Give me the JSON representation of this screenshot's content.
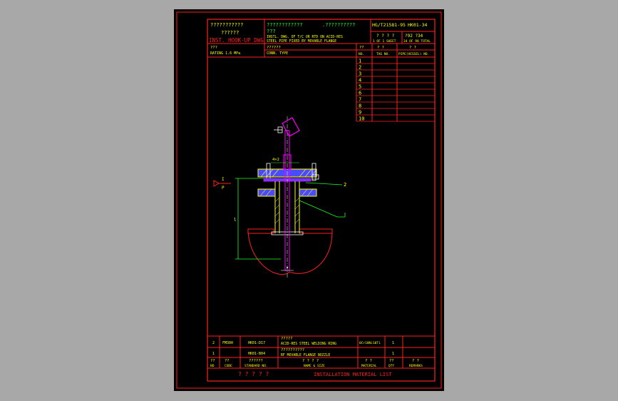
{
  "colors": {
    "frame": "#ff2020",
    "text": "#ffff00",
    "pipe": "#ff00ff",
    "blue": "#4a4aff",
    "green": "#20ff20",
    "white": "#ffffff",
    "cyan": "#00ffff"
  },
  "title_block": {
    "cn_inst": "???????????",
    "cn_hookup": "??????",
    "inst_hookup": "INST. HOOK-UP DWG",
    "cn_title_a": "????????????",
    "cn_title_b": ".??????????",
    "cn_title_c": "???",
    "en_title_1": "INSTL. DWG. OF T/C OR RTD ON ACID-RES",
    "en_title_2": "STEEL PIPE FIXED BY MOVABLE FLANGE",
    "std_no": "HG/T21581-95",
    "dwg_no": "HK01-34",
    "sheet_cn": "? ? ? ?",
    "sheet_val": "1 OF 1 SHEET",
    "total_cn": "?92 ?34",
    "total_val": "34 OF 98 TOTAL",
    "rating_cn": "???",
    "rating": "RATING  1.6 MPa",
    "conn_cn": "??????",
    "conn_type": "CONN. TYPE"
  },
  "right_table": {
    "headers_cn": [
      "??",
      "? ?",
      "? ?"
    ],
    "headers": [
      "NO.",
      "TAG NO.",
      "PIPE(VESSEL) NO."
    ],
    "rows": [
      "1",
      "2",
      "3",
      "4",
      "5",
      "6",
      "7",
      "8",
      "9",
      "10"
    ]
  },
  "drawing": {
    "label_i": "I",
    "label_p": "P",
    "label_2": "2",
    "label_dim": "4×2",
    "label_l": "l"
  },
  "material_list": {
    "rows": [
      {
        "no": "2",
        "code": "FM300",
        "standard": "HK01-D17",
        "name_cn": "?????",
        "name": "ACID-RES  STEEL WELDING RING",
        "material": "0Cr18Ni10Ti",
        "qty": "1",
        "remarks": ""
      },
      {
        "no": "1",
        "code": "",
        "standard": "HK01-B04",
        "name_cn": "??????????",
        "name": "RF MOVABLE FLANGE NOZZLE",
        "material": "",
        "qty": "1",
        "remarks": ""
      }
    ],
    "headers_cn": [
      "??",
      "??",
      "??????",
      "? ? ? ?",
      "? ?",
      "??",
      "? ?"
    ],
    "headers": [
      "NO",
      "CODE",
      "STANDARD NO.",
      "NAME & SIZE",
      "MATERIAL",
      "QTY",
      "REMARKS"
    ],
    "footer_cn": "? ? ? ? ?",
    "footer": "INSTALLATION MATERIAL LIST"
  }
}
